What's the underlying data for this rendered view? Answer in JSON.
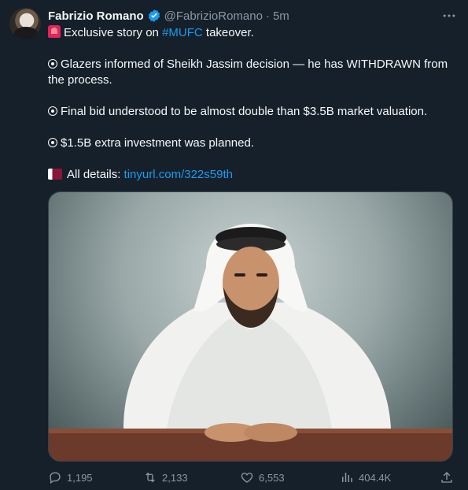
{
  "author": {
    "name": "Fabrizio Romano",
    "handle": "@FabrizioRomano",
    "separator": "·",
    "time": "5m"
  },
  "tweet": {
    "line1_prefix": "Exclusive story on",
    "line1_hashtag": "#MUFC",
    "line1_suffix": "takeover.",
    "para2": "Glazers informed of Sheikh Jassim decision — he has WITHDRAWN from the process.",
    "para3": "Final bid understood to be almost double than $3.5B market valuation.",
    "para4": "$1.5B extra investment was planned.",
    "details_label": "All details:",
    "details_link": "tinyurl.com/322s59th"
  },
  "stats": {
    "replies": "1,195",
    "retweets": "2,133",
    "likes": "6,553",
    "views": "404.4K"
  },
  "icons": [
    "verified-badge-icon",
    "more-icon",
    "siren-icon",
    "bullet-icon",
    "qatar-flag-icon",
    "reply-icon",
    "retweet-icon",
    "like-icon",
    "views-icon",
    "share-icon"
  ],
  "colors": {
    "background": "#15202b",
    "accent": "#1d9bf0",
    "muted": "#8b98a5",
    "text": "#f7f9f9"
  }
}
